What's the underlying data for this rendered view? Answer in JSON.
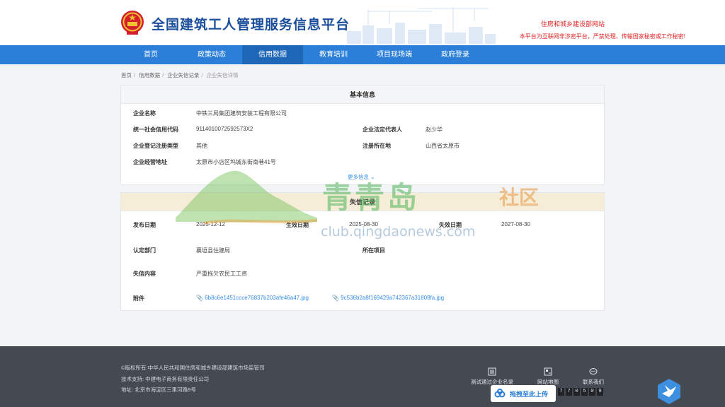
{
  "header": {
    "site_title": "全国建筑工人管理服务信息平台",
    "ministry_link": "住房和城乡建设部网站",
    "warning": "本平台为互联网非涉密平台，严禁处理、传输国家秘密或工作秘密!"
  },
  "nav": {
    "items": [
      {
        "label": "首页"
      },
      {
        "label": "政策动态"
      },
      {
        "label": "信用数据",
        "active": true
      },
      {
        "label": "教育培训"
      },
      {
        "label": "项目现场端"
      },
      {
        "label": "政府登录"
      }
    ]
  },
  "breadcrumb": [
    "首页",
    "信用数据",
    "企业失信记录",
    "企业失信详情"
  ],
  "basic_info": {
    "title": "基本信息",
    "company_name_label": "企业名称",
    "company_name": "中铁三局集团建筑安装工程有限公司",
    "credit_code_label": "统一社会信用代码",
    "credit_code": "9114010072592573X2",
    "legal_rep_label": "企业法定代表人",
    "legal_rep": "赵少华",
    "reg_type_label": "企业登记注册类型",
    "reg_type": "其他",
    "reg_location_label": "注册所在地",
    "reg_location": "山西省太原市",
    "address_label": "企业经营地址",
    "address": "太原市小店区坞城东街南巷41号",
    "more_label": "更多信息"
  },
  "dishonest": {
    "title": "失信记录",
    "publish_date_label": "发布日期",
    "publish_date": "2025-12-12",
    "effective_date_label": "生效日期",
    "effective_date": "2025-08-30",
    "expiry_date_label": "失效日期",
    "expiry_date": "2027-08-30",
    "dept_label": "认定部门",
    "dept": "襄垣县住建局",
    "project_label": "所在项目",
    "project": "",
    "content_label": "失信内容",
    "content": "严重拖欠农民工工资",
    "attach_label": "附件",
    "attachments": [
      "6b8c6e1451ccce76837b203afe46a47.jpg",
      "9c536b2a8f169429a742367a31808fa.jpg"
    ]
  },
  "watermark": {
    "brand": "青青岛",
    "suffix": "社区",
    "url": "club.qingdaonews.com"
  },
  "footer": {
    "copyright": "©版权所有:中华人民共和国住房和城乡建设部建筑市场监管司",
    "tech_support": "技术支持:  中建电子商务有限责任公司",
    "address": "地址:  北京市海淀区三里河路9号",
    "links": [
      {
        "label": "测试通过企业名录",
        "icon": "list-icon"
      },
      {
        "label": "网站地图",
        "icon": "sitemap-icon"
      },
      {
        "label": "联系我们",
        "icon": "chat-icon"
      }
    ],
    "upload_label": "拖拽至此上传",
    "counter_digits": [
      "7",
      "7",
      "0",
      "5",
      "0",
      "9"
    ]
  },
  "colors": {
    "nav_bg": "#2b7fd8",
    "nav_active": "#1e66b8",
    "title": "#1b4f9c",
    "warning": "#e02020",
    "footer_bg": "#454a52",
    "link": "#3a8ee6"
  }
}
